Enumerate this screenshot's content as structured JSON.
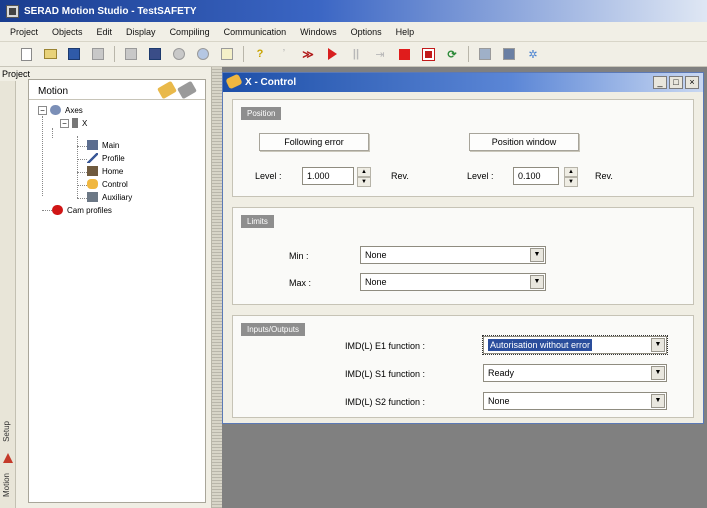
{
  "window": {
    "title": "SERAD Motion Studio - TestSAFETY"
  },
  "menu": [
    "Project",
    "Objects",
    "Edit",
    "Display",
    "Compiling",
    "Communication",
    "Windows",
    "Options",
    "Help"
  ],
  "project_pane": {
    "label": "Project",
    "side_tabs": [
      "Setup",
      "Motion"
    ],
    "tree_title": "Motion",
    "tree": {
      "axes": "Axes",
      "axis": "X",
      "children": [
        "Main",
        "Profile",
        "Home",
        "Control",
        "Auxiliary"
      ],
      "cam_profiles": "Cam profiles"
    }
  },
  "child_window": {
    "title": "X - Control",
    "buttons": {
      "minimize": "_",
      "maximize": "□",
      "close": "×"
    },
    "position": {
      "label": "Position",
      "following_error_button": "Following error",
      "position_window_button": "Position window",
      "level_label": "Level :",
      "level_left_value": "1.000",
      "level_left_unit": "Rev.",
      "level_right_value": "0.100",
      "level_right_unit": "Rev."
    },
    "limits": {
      "label": "Limits",
      "min_label": "Min :",
      "min_value": "None",
      "max_label": "Max :",
      "max_value": "None"
    },
    "io": {
      "label": "Inputs/Outputs",
      "e1_label": "IMD(L) E1 function :",
      "e1_value": "Autorisation without error",
      "s1_label": "IMD(L) S1 function :",
      "s1_value": "Ready",
      "s2_label": "IMD(L) S2 function :",
      "s2_value": "None"
    }
  }
}
